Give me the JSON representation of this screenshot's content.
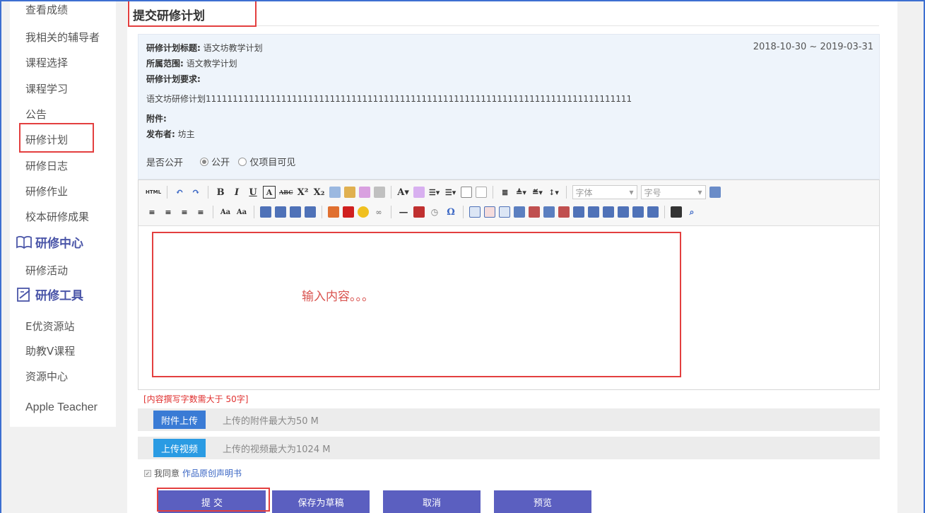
{
  "sidebar": {
    "items_top": [
      "查看成绩",
      "我相关的辅导者",
      "课程选择",
      "课程学习",
      "公告",
      "研修计划",
      "研修日志",
      "研修作业",
      "校本研修成果"
    ],
    "section_center": "研修中心",
    "items_center": [
      "研修活动"
    ],
    "section_tools": "研修工具",
    "items_tools": [
      "E优资源站",
      "助教V课程",
      "资源中心",
      "Apple Teacher"
    ]
  },
  "main": {
    "title": "提交研修计划",
    "info": {
      "plan_title_label": "研修计划标题:",
      "plan_title": "语文坊教学计划",
      "date_range": "2018-10-30 ~ 2019-03-31",
      "scope_label": "所属范围:",
      "scope": "语文教学计划",
      "req_label": "研修计划要求:",
      "req_text": "语文坊研修计划1111111111111111111111111111111111111111111111111111111111111111111111111111111",
      "attach_label": "附件:",
      "publisher_label": "发布者:",
      "publisher": "坊主",
      "public_label": "是否公开",
      "opt_public": "公开",
      "opt_private": "仅项目可见"
    },
    "editor": {
      "html_btn": "HTML",
      "font_placeholder": "字体",
      "size_placeholder": "字号",
      "placeholder": "输入内容。。。"
    },
    "hint": "[内容撰写字数需大于 50字]",
    "uploads": {
      "attach_btn": "附件上传",
      "attach_hint": "上传的附件最大为50 M",
      "video_btn": "上传视频",
      "video_hint": "上传的视频最大为1024 M"
    },
    "agree_prefix": "我同意",
    "agree_link": "作品原创声明书",
    "buttons": {
      "submit": "提 交",
      "draft": "保存为草稿",
      "cancel": "取消",
      "preview": "预览"
    },
    "colors": {
      "accent": "#5b5fc0",
      "attach_btn": "#3a7bd5",
      "video_btn": "#2a9be3",
      "highlight": "#e33f3f"
    }
  }
}
